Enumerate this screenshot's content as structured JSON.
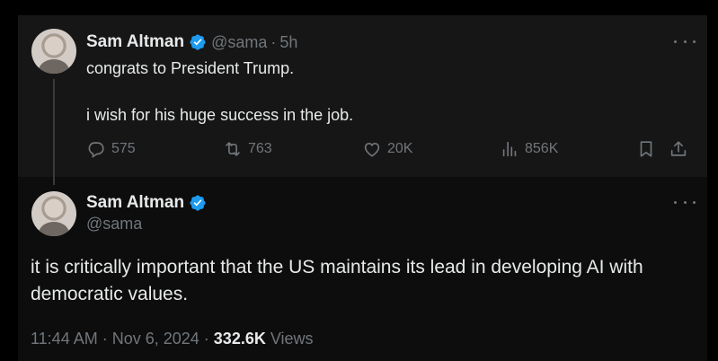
{
  "accent_color": "#1d9bf0",
  "tweet1": {
    "name": "Sam Altman",
    "handle": "@sama",
    "separator": "·",
    "time": "5h",
    "text_line1": "congrats to President Trump.",
    "text_line2": "i wish for his huge success in the job.",
    "replies": "575",
    "retweets": "763",
    "likes": "20K",
    "views": "856K",
    "icons": [
      "reply-icon",
      "retweet-icon",
      "like-icon",
      "views-icon",
      "bookmark-icon",
      "share-icon",
      "more-icon",
      "verified-icon"
    ]
  },
  "tweet2": {
    "name": "Sam Altman",
    "handle": "@sama",
    "text": "it is critically important that the US maintains its lead in developing AI with democratic values.",
    "timestamp": "11:44 AM · Nov 6, 2024 ·",
    "views_count": "332.6K",
    "views_label": "Views"
  }
}
